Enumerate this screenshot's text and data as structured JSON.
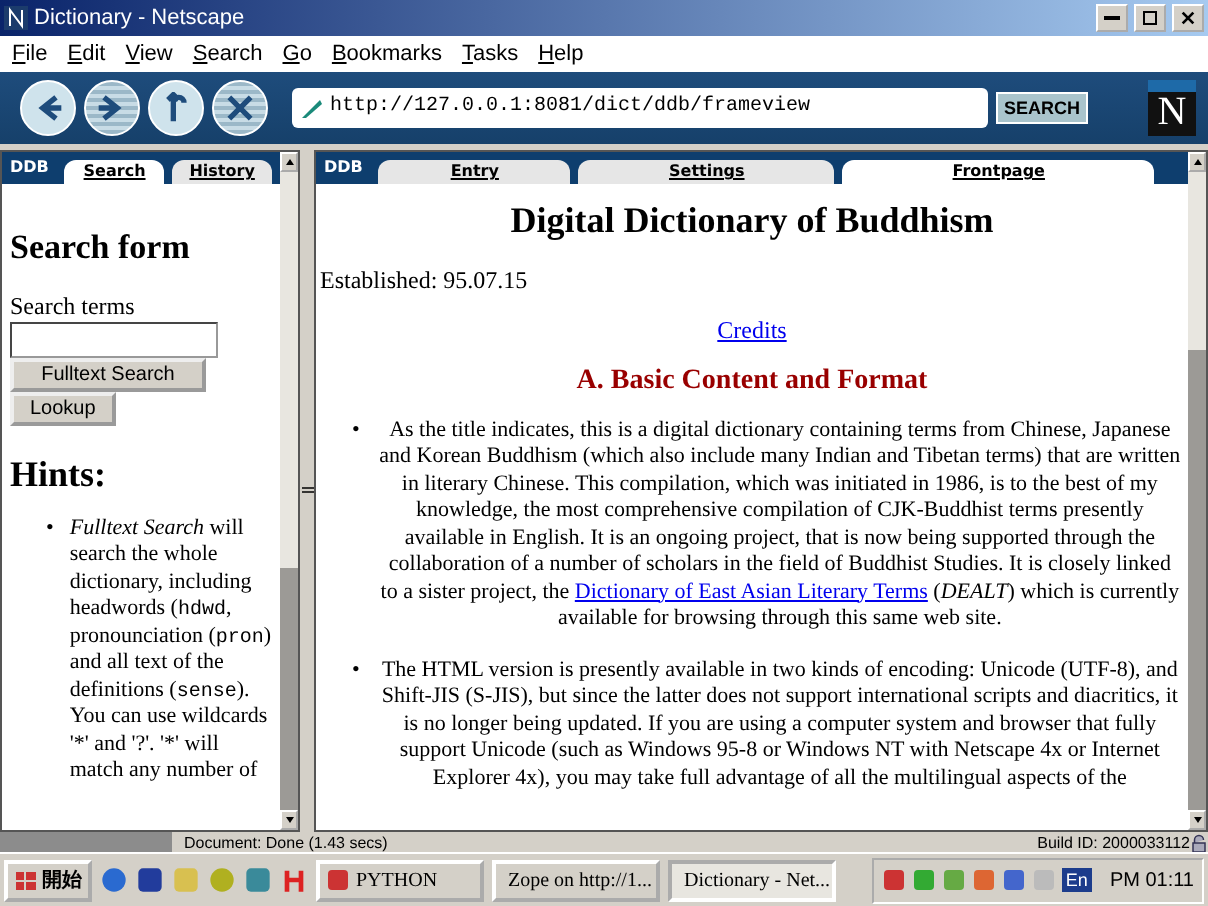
{
  "window": {
    "title": "Dictionary - Netscape"
  },
  "menu": [
    "File",
    "Edit",
    "View",
    "Search",
    "Go",
    "Bookmarks",
    "Tasks",
    "Help"
  ],
  "toolbar": {
    "address": "http://127.0.0.1:8081/dict/ddb/frameview",
    "search_button": "SEARCH",
    "logo": "N"
  },
  "left_frame": {
    "brand": "DDB",
    "tabs": [
      {
        "label": "Search",
        "selected": true
      },
      {
        "label": "History",
        "selected": false
      }
    ],
    "heading": "Search form",
    "field_label": "Search terms",
    "buttons": [
      "Fulltext Search",
      "Lookup"
    ],
    "hints_heading": "Hints:",
    "bullet": "•",
    "hints": [
      [
        {
          "kind": "italic",
          "text": "Fulltext Search"
        },
        {
          "kind": "plain",
          "text": " will search the whole dictionary, including headwords ("
        },
        {
          "kind": "code",
          "text": "hdwd"
        },
        {
          "kind": "plain",
          "text": ", pronounciation ("
        },
        {
          "kind": "code",
          "text": "pron"
        },
        {
          "kind": "plain",
          "text": ") and all text of the definitions ("
        },
        {
          "kind": "code",
          "text": "sense"
        },
        {
          "kind": "plain",
          "text": "). You can use wildcards '*' and '?'. '*' will match any number of"
        }
      ]
    ]
  },
  "right_frame": {
    "brand": "DDB",
    "tabs": [
      {
        "label": "Entry",
        "selected": false
      },
      {
        "label": "Settings",
        "selected": false
      },
      {
        "label": "Frontpage",
        "selected": true
      }
    ],
    "title": "Digital Dictionary of Buddhism",
    "established": "Established: 95.07.15",
    "credits_link": "Credits",
    "section_heading": "A. Basic Content and Format",
    "bullet": "•",
    "paragraphs": [
      [
        {
          "kind": "plain",
          "text": "As the title indicates, this is a digital dictionary containing terms from Chinese, Japanese and Korean Buddhism (which also include many Indian and Tibetan terms) that are written in literary Chinese. This compilation, which was initiated in 1986, is to the best of my knowledge, the most comprehensive compilation of CJK-Buddhist terms presently available in English. It is an ongoing project, that is now being supported through the collaboration of a number of scholars in the field of Buddhist Studies. It is closely linked to a sister project, the "
        },
        {
          "kind": "link",
          "text": "Dictionary of East Asian Literary Terms"
        },
        {
          "kind": "plain",
          "text": " ("
        },
        {
          "kind": "italic",
          "text": "DEALT"
        },
        {
          "kind": "plain",
          "text": ") which is currently available for browsing through this same web site."
        }
      ],
      [
        {
          "kind": "plain",
          "text": "The HTML version is presently available in two kinds of encoding: Unicode (UTF-8), and Shift-JIS (S-JIS), but since the latter does not support international scripts and diacritics, it is no longer being updated. If you are using a computer system and browser that fully support Unicode (such as Windows 95-8 or Windows NT with Netscape 4x or Internet Explorer 4x), you may take full advantage of all the multilingual aspects of the"
        }
      ]
    ]
  },
  "status_bar": {
    "message": "Document: Done (1.43 secs)",
    "build": "Build ID: 2000033112"
  },
  "taskbar": {
    "start": "開始",
    "tasks": [
      {
        "label": "PYTHON",
        "selected": false
      },
      {
        "label": "Zope on http://1...",
        "selected": false
      },
      {
        "label": "Dictionary - Net...",
        "selected": true
      }
    ],
    "language": "En",
    "clock": "PM 01:11"
  }
}
